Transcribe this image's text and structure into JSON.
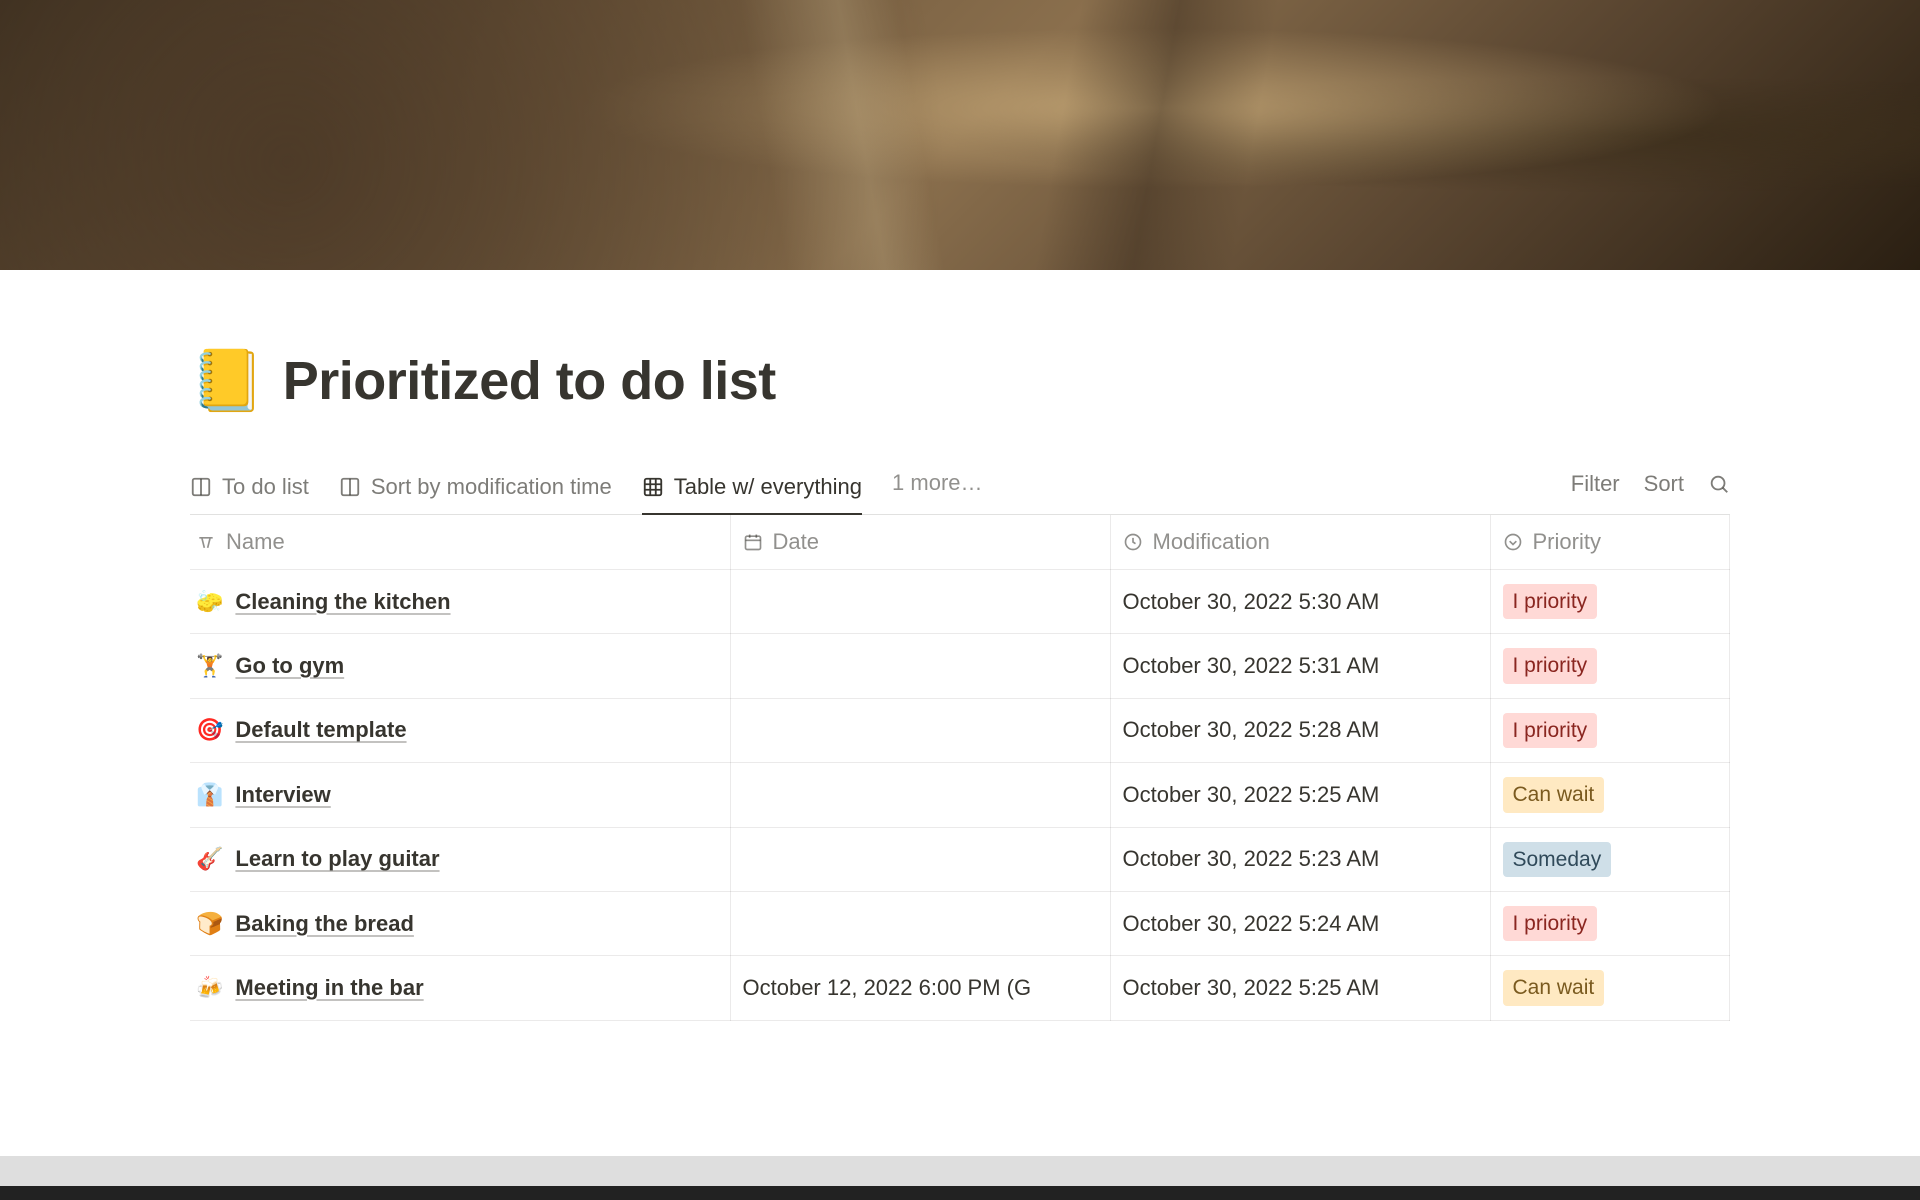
{
  "page": {
    "icon": "📒",
    "title": "Prioritized to do list"
  },
  "views": {
    "tabs": [
      {
        "label": "To do list",
        "icon": "board"
      },
      {
        "label": "Sort by modification time",
        "icon": "board"
      },
      {
        "label": "Table w/ everything",
        "icon": "table",
        "active": true
      }
    ],
    "more_label": "1 more…",
    "actions": {
      "filter": "Filter",
      "sort": "Sort"
    }
  },
  "columns": {
    "name": "Name",
    "date": "Date",
    "modification": "Modification",
    "priority": "Priority"
  },
  "priority_styles": {
    "I priority": "tag-i-priority",
    "Can wait": "tag-can-wait",
    "Someday": "tag-someday"
  },
  "rows": [
    {
      "emoji": "🧽",
      "name": "Cleaning the kitchen",
      "date": "",
      "modification": "October 30, 2022 5:30 AM",
      "priority": "I priority"
    },
    {
      "emoji": "🏋️",
      "name": "Go to gym",
      "date": "",
      "modification": "October 30, 2022 5:31 AM",
      "priority": "I priority"
    },
    {
      "emoji": "🎯",
      "name": "Default template",
      "date": "",
      "modification": "October 30, 2022 5:28 AM",
      "priority": "I priority"
    },
    {
      "emoji": "👔",
      "name": "Interview",
      "date": "",
      "modification": "October 30, 2022 5:25 AM",
      "priority": "Can wait"
    },
    {
      "emoji": "🎸",
      "name": "Learn to play guitar",
      "date": "",
      "modification": "October 30, 2022 5:23 AM",
      "priority": "Someday"
    },
    {
      "emoji": "🍞",
      "name": "Baking the bread",
      "date": "",
      "modification": "October 30, 2022 5:24 AM",
      "priority": "I priority"
    },
    {
      "emoji": "🍻",
      "name": "Meeting in the bar",
      "date": "October 12, 2022 6:00 PM (G",
      "modification": "October 30, 2022 5:25 AM",
      "priority": "Can wait"
    }
  ]
}
